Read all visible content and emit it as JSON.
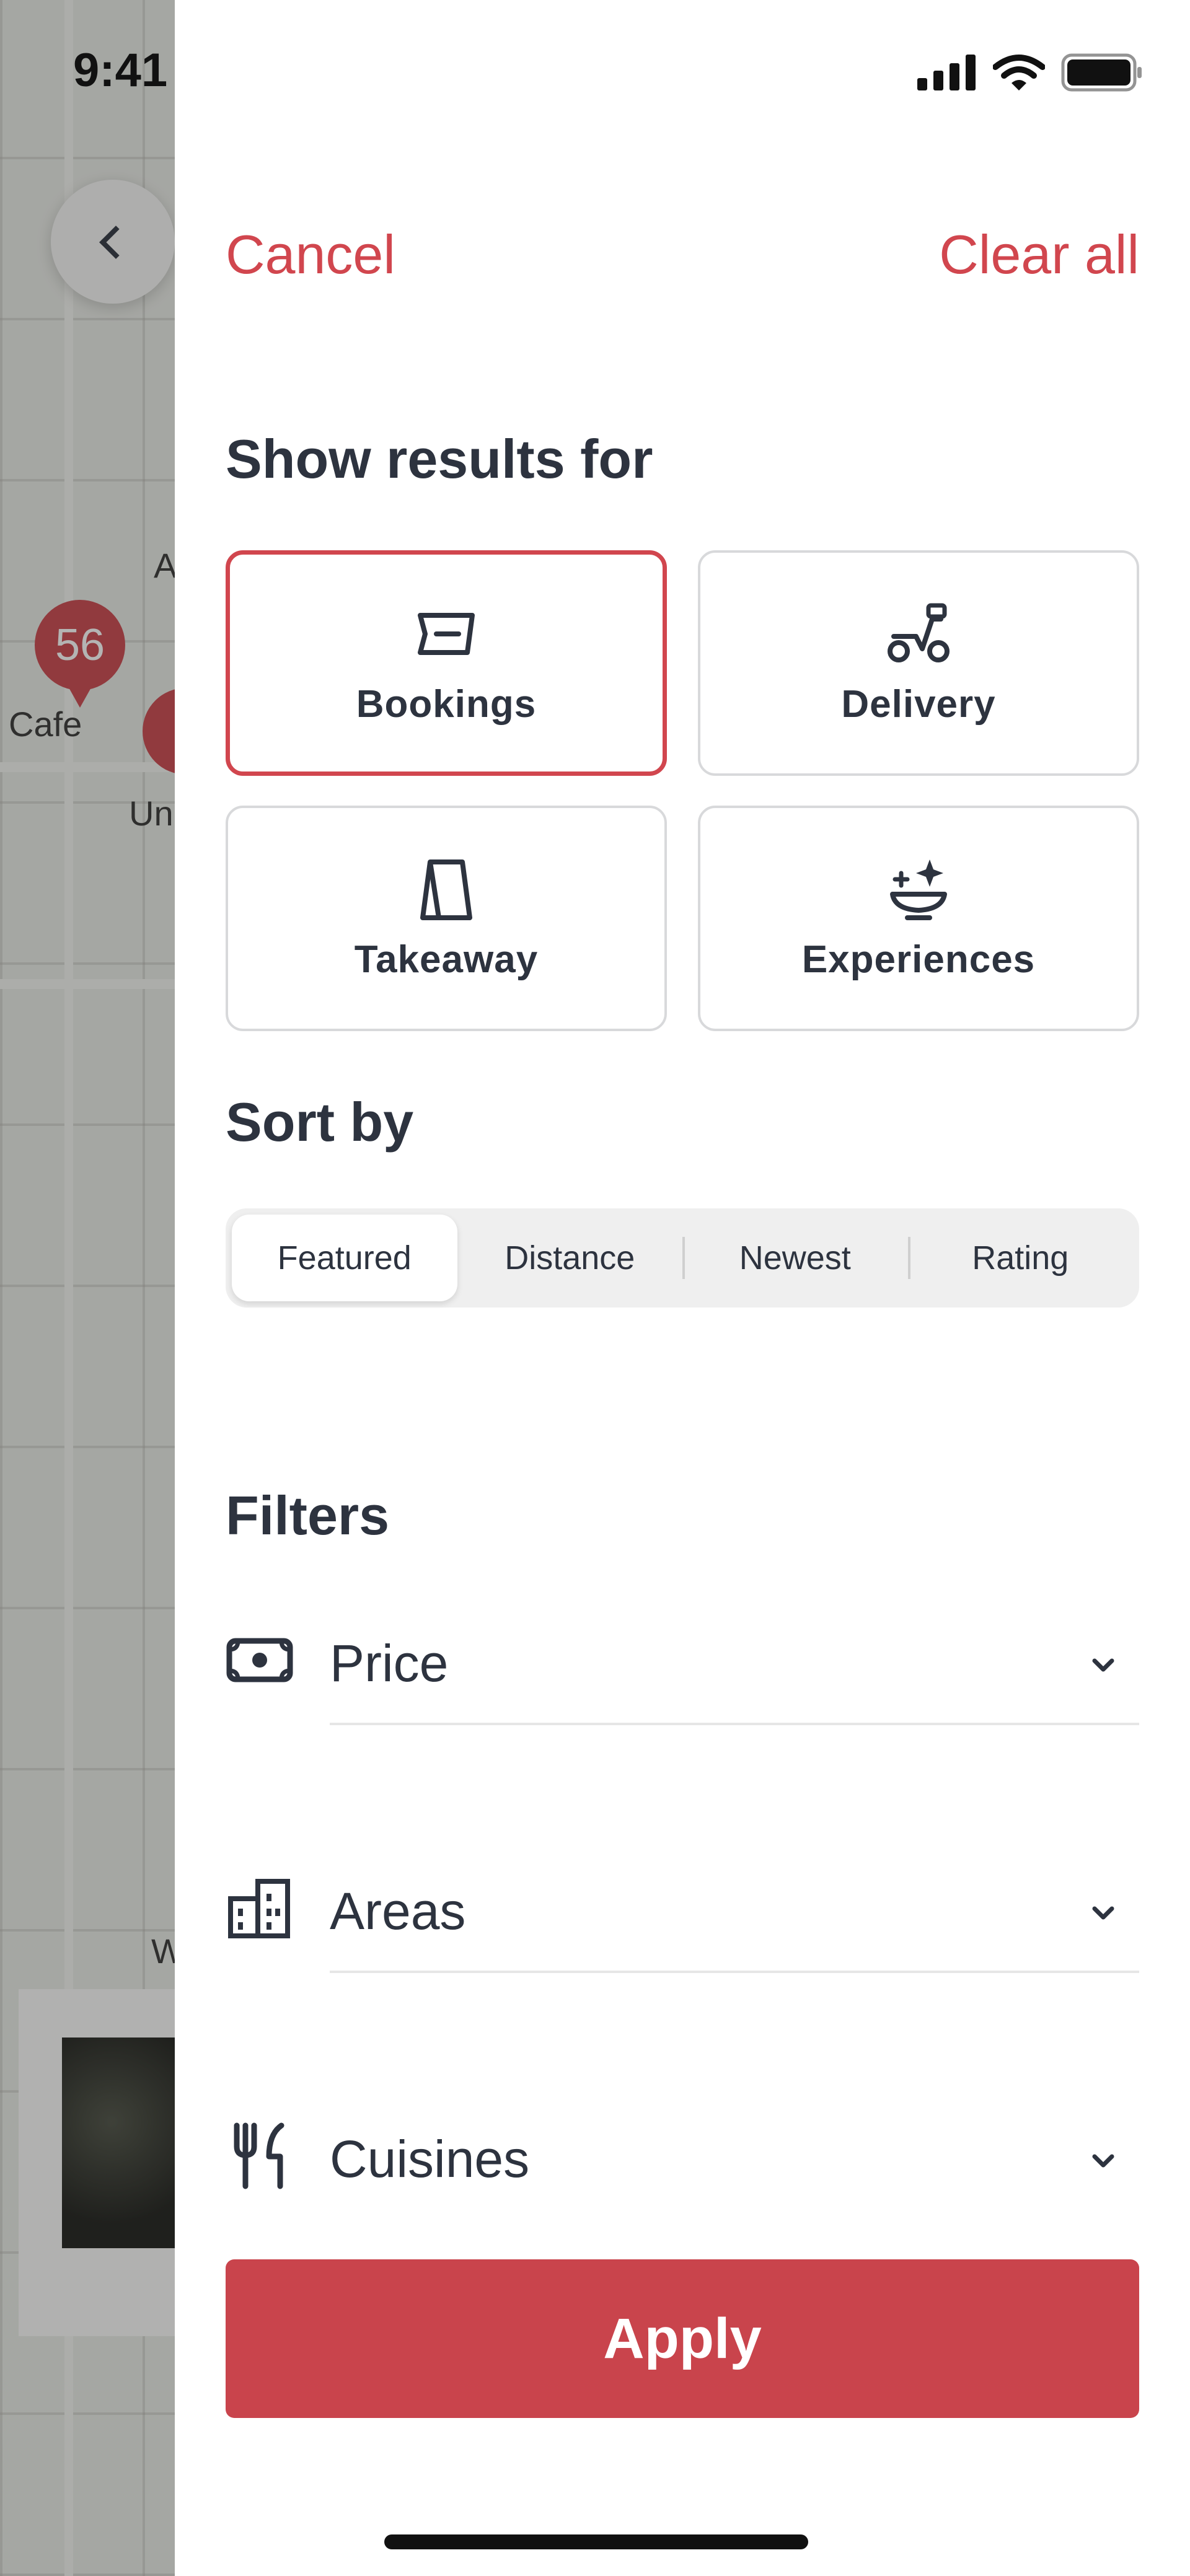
{
  "status_bar": {
    "time": "9:41"
  },
  "map": {
    "pin_count": "56",
    "labels": {
      "cafe": "Cafe",
      "partial_a": "A",
      "partial_un": "Un",
      "partial_w": "W"
    }
  },
  "sheet": {
    "cancel_label": "Cancel",
    "clear_all_label": "Clear all",
    "show_results_title": "Show results for",
    "result_types": [
      {
        "label": "Bookings",
        "icon": "ticket-icon",
        "selected": true
      },
      {
        "label": "Delivery",
        "icon": "scooter-icon",
        "selected": false
      },
      {
        "label": "Takeaway",
        "icon": "takeaway-bag-icon",
        "selected": false
      },
      {
        "label": "Experiences",
        "icon": "sparkle-dish-icon",
        "selected": false
      }
    ],
    "sort_title": "Sort by",
    "sort_options": [
      {
        "label": "Featured",
        "active": true
      },
      {
        "label": "Distance",
        "active": false
      },
      {
        "label": "Newest",
        "active": false
      },
      {
        "label": "Rating",
        "active": false
      }
    ],
    "filters_title": "Filters",
    "filters": [
      {
        "label": "Price",
        "icon": "money-icon"
      },
      {
        "label": "Areas",
        "icon": "buildings-icon"
      },
      {
        "label": "Cuisines",
        "icon": "fork-knife-icon"
      }
    ],
    "apply_label": "Apply",
    "accent_color": "#d1464e"
  }
}
